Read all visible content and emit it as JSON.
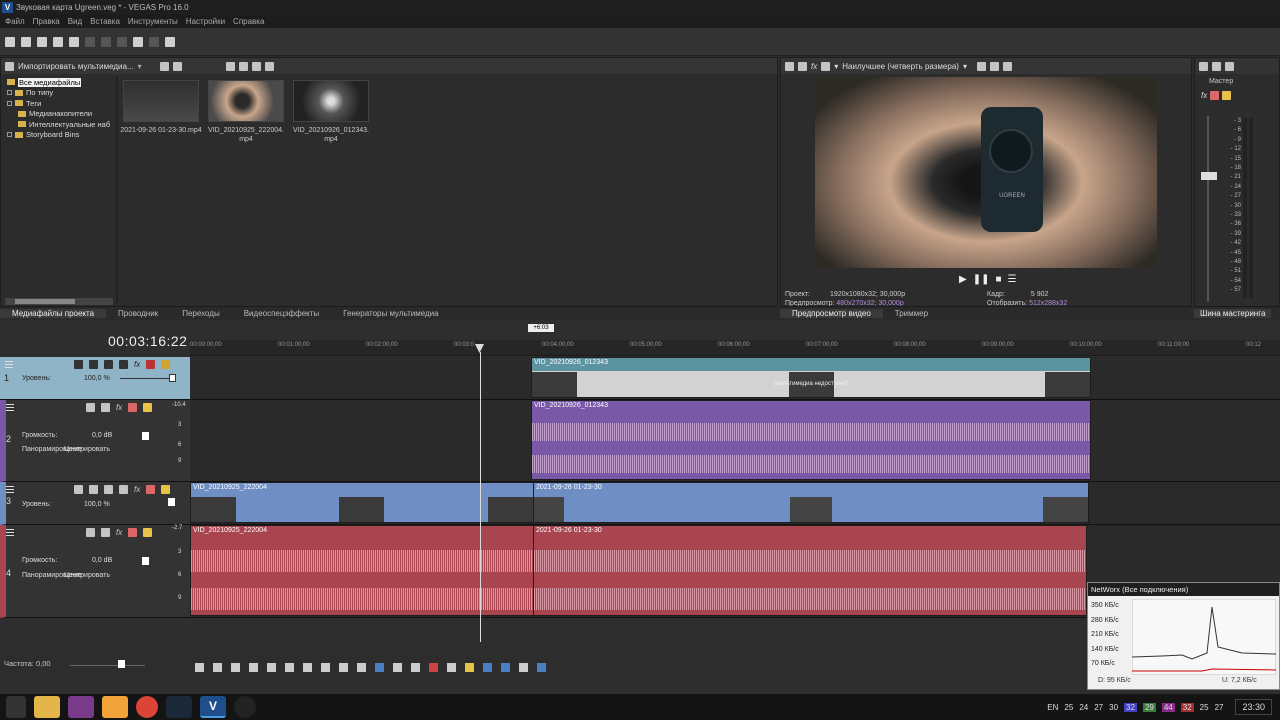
{
  "window": {
    "title": "Звуковая карта Ugreen.veg * - VEGAS Pro 16.0",
    "logo": "V"
  },
  "menu": [
    "Файл",
    "Правка",
    "Вид",
    "Вставка",
    "Инструменты",
    "Настройки",
    "Справка"
  ],
  "media_panel": {
    "import_label": "Импортировать мультимедиа...",
    "tree": [
      "Все медиафайлы",
      "По типу",
      "Теги",
      "Медианакопители",
      "Интеллектуальные наб",
      "Storyboard Bins"
    ],
    "files": [
      {
        "name": "2021-09-26 01-23-30.mp4"
      },
      {
        "name": "VID_20210925_222004. mp4"
      },
      {
        "name": "VID_20210926_012343. mp4"
      }
    ],
    "tabs": [
      "Медиафайлы проекта",
      "Проводник",
      "Переходы",
      "Видеоспецэффекты",
      "Генераторы мультимедиа"
    ]
  },
  "preview": {
    "quality": "Наилучшее (четверть размера)",
    "device_text": "UGREEN",
    "info": {
      "project_label": "Проект:",
      "project_value": "1920x1080x32; 30,000p",
      "preview_label": "Предпросмотр:",
      "preview_value": "480x270x32; 30,000p",
      "frame_label": "Кадр:",
      "frame_value": "5 902",
      "display_label": "Отобразить:",
      "display_value": "512x288x32"
    },
    "tabs": [
      "Предпросмотр видео",
      "Триммер"
    ]
  },
  "master": {
    "label": "Мастер",
    "tab": "Шина мастеринга",
    "scale": [
      "3",
      "6",
      "9",
      "12",
      "15",
      "18",
      "21",
      "24",
      "27",
      "30",
      "33",
      "36",
      "39",
      "42",
      "45",
      "48",
      "51",
      "54",
      "57"
    ]
  },
  "timeline": {
    "timecode": "00:03:16:22",
    "marker": "+6:03",
    "ruler": [
      "00:00:00;00",
      "00:01:00;00",
      "00:02:00;00",
      "00:03:0",
      "00:04:00;00",
      "00:05:00;00",
      "00:06:00;00",
      "00:07:00;00",
      "00:08:00;00",
      "00:09:00;00",
      "00:10:00;00",
      "00:11:00;00",
      "00:12"
    ],
    "tracks": [
      {
        "num": "1",
        "level_label": "Уровень:",
        "level_value": "100,0 %"
      },
      {
        "num": "2",
        "vol_label": "Громкость:",
        "vol_value": "0,0 dB",
        "pan_label": "Панорамирование",
        "pan_value": "Центрировать",
        "meter_top": "-10.4"
      },
      {
        "num": "3",
        "level_label": "Уровень:",
        "level_value": "100,0 %"
      },
      {
        "num": "4",
        "vol_label": "Громкость:",
        "vol_value": "0,0 dB",
        "pan_label": "Панорамирование",
        "pan_value": "Центрировать",
        "meter_top": "-2.7"
      }
    ],
    "db_ticks": [
      "3",
      "6",
      "9"
    ],
    "events": {
      "v1": "VID_20210926_012343",
      "a1": "VID_20210926_012343",
      "v2a": "VID_20210925_222004",
      "v2b": "2021-09-26 01-23-30",
      "a2a": "VID_20210925_222004",
      "a2b": "2021-09-26 01-23-30",
      "offline": "(мультимедиа недоступно)"
    },
    "rate": "Частота: 0,00"
  },
  "networx": {
    "title": "NetWorx (Все подключения)",
    "scale": [
      "350 КБ/с",
      "280 КБ/с",
      "210 КБ/с",
      "140 КБ/с",
      "70 КБ/с"
    ],
    "down": "D: 95 КБ/с",
    "up": "U: 7,2 КБ/с"
  },
  "taskbar": {
    "lang": "EN",
    "clock": "23:30",
    "tray_nums": [
      "25",
      "24",
      "27",
      "30",
      "32",
      "29",
      "44",
      "32",
      "25",
      "27"
    ]
  },
  "colors": {
    "video_track": "#6f8fc4",
    "audio1": "#7a58a8",
    "audio2": "#a9454f",
    "teal": "#5c93a1"
  }
}
